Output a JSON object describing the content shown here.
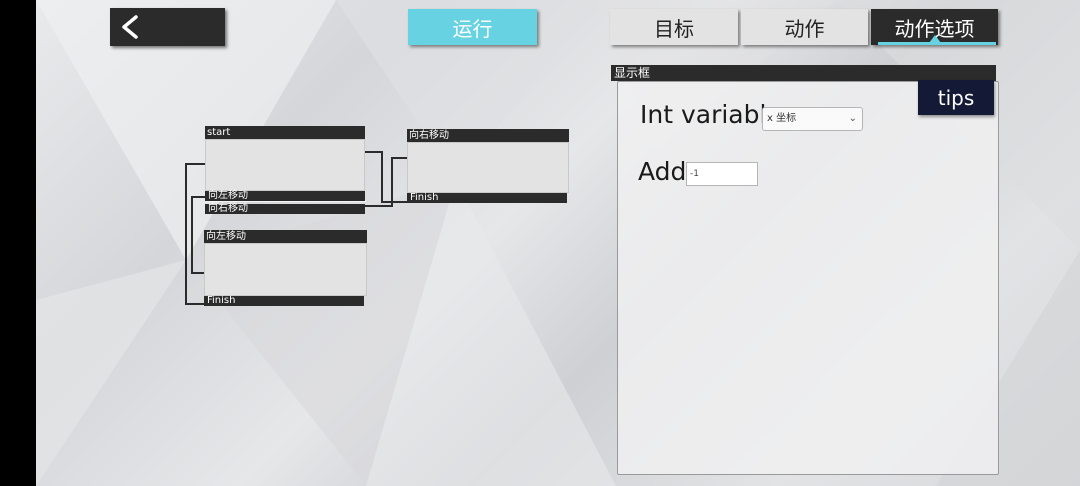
{
  "header": {
    "back_icon": "chevron-left-icon",
    "run_label": "运行",
    "tabs": [
      {
        "label": "目标",
        "active": false
      },
      {
        "label": "动作",
        "active": false
      },
      {
        "label": "动作选项",
        "active": true
      }
    ],
    "accent_color": "#66d2e2"
  },
  "graph": {
    "nodes": [
      {
        "title": "start",
        "ports": [
          "向左移动",
          "向右移动"
        ]
      },
      {
        "title": "向左移动",
        "ports": [
          "Finish"
        ]
      },
      {
        "title": "向右移动",
        "ports": [
          "Finish"
        ]
      }
    ]
  },
  "panel": {
    "title": "显示框",
    "tips_label": "tips",
    "int_variable_label": "Int variable",
    "variable_value": "x 坐标",
    "add_label": "Add",
    "add_value": "-1"
  }
}
